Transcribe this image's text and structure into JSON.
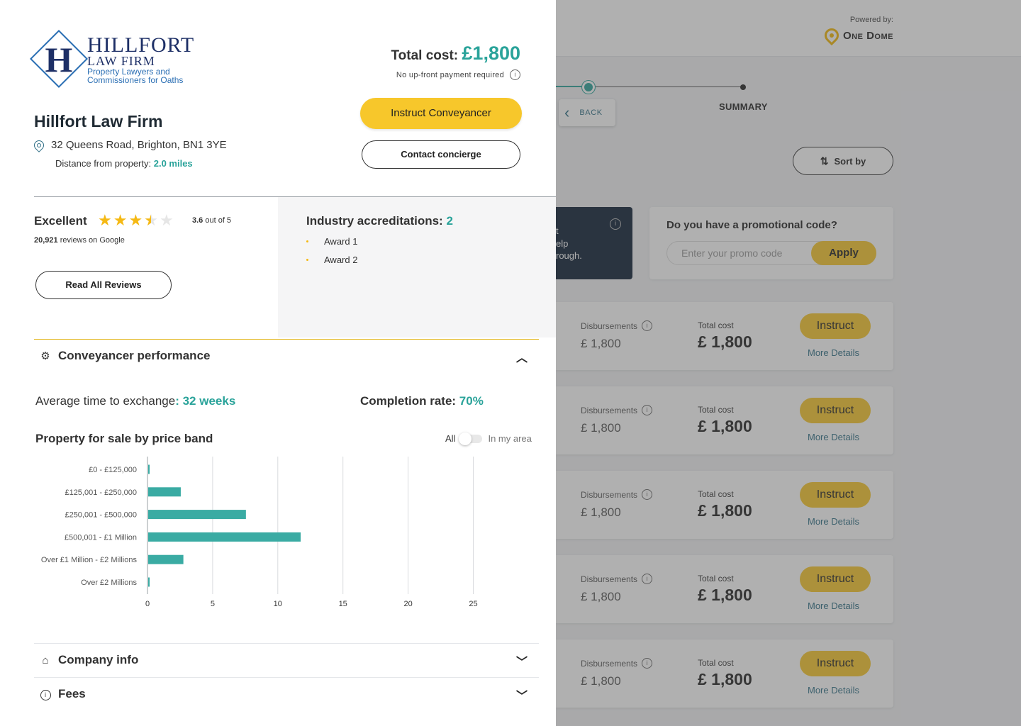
{
  "background": {
    "powered_by": "Powered by:",
    "brand": "One Dome",
    "back_label": "BACK",
    "summary_label": "SUMMARY",
    "sort_label": "Sort by",
    "dark_card": {
      "line1": "t",
      "line2": "elp",
      "line3": "rough."
    },
    "promo": {
      "question": "Do you have a promotional code?",
      "placeholder": "Enter your promo code",
      "apply": "Apply"
    },
    "quotes": [
      {
        "dis_label": "Disbursements",
        "dis_value": "£ 1,800",
        "total_label": "Total cost",
        "total_value": "£ 1,800",
        "instruct": "Instruct",
        "more": "More Details"
      },
      {
        "dis_label": "Disbursements",
        "dis_value": "£ 1,800",
        "total_label": "Total cost",
        "total_value": "£ 1,800",
        "instruct": "Instruct",
        "more": "More Details"
      },
      {
        "dis_label": "Disbursements",
        "dis_value": "£ 1,800",
        "total_label": "Total cost",
        "total_value": "£ 1,800",
        "instruct": "Instruct",
        "more": "More Details"
      },
      {
        "dis_label": "Disbursements",
        "dis_value": "£ 1,800",
        "total_label": "Total cost",
        "total_value": "£ 1,800",
        "instruct": "Instruct",
        "more": "More Details"
      },
      {
        "dis_label": "Disbursements",
        "dis_value": "£ 1,800",
        "total_label": "Total cost",
        "total_value": "£ 1,800",
        "instruct": "Instruct",
        "more": "More Details"
      }
    ]
  },
  "panel": {
    "logo": {
      "name1": "HILLFORT",
      "name2": "LAW FIRM",
      "tagline1": "Property Lawyers and",
      "tagline2": "Commissioners for Oaths"
    },
    "firm_name": "Hillfort Law Firm",
    "address": "32 Queens Road, Brighton, BN1 3YE",
    "distance_label": "Distance from property:",
    "distance_value": "2.0 miles",
    "total_label": "Total cost:",
    "total_value": "£1,800",
    "no_payment": "No up-front payment required",
    "instruct_button": "Instruct Conveyancer",
    "concierge_button": "Contact concierge",
    "rating": {
      "word": "Excellent",
      "score": 3.6,
      "score_bold": "3.6",
      "score_suffix": "out of 5",
      "review_count": "20,921",
      "review_suffix": "reviews on Google",
      "read_all": "Read All Reviews"
    },
    "accreditations": {
      "label": "Industry accreditations:",
      "count": "2",
      "awards": [
        "Award 1",
        "Award 2"
      ]
    },
    "performance": {
      "title": "Conveyancer performance",
      "avg_label": "Average time to exchange",
      "avg_value": "32 weeks",
      "completion_label": "Completion rate:",
      "completion_value": "70%",
      "chart_title": "Property for sale by price band",
      "toggle_all": "All",
      "toggle_area": "In my area"
    },
    "company_info": "Company info",
    "fees": "Fees"
  },
  "colors": {
    "accent": "#2aa39a",
    "button_yellow": "#f7c72b",
    "star": "#f5b914",
    "dark_navy": "#0b1e34"
  },
  "chart_data": {
    "type": "bar",
    "orientation": "horizontal",
    "categories": [
      "£0 - £125,000",
      "£125,001 - £250,000",
      "£250,001 - £500,000",
      "£500,001 - £1 Million",
      "Over £1 Million - £2 Millions",
      "Over £2 Millions"
    ],
    "values": [
      0.1,
      2.5,
      7.5,
      11.7,
      2.7,
      0.1
    ],
    "xticks": [
      0,
      5,
      10,
      15,
      20,
      25
    ],
    "xlim": [
      0,
      29
    ],
    "grid": true,
    "bar_color": "#3aaba3"
  }
}
